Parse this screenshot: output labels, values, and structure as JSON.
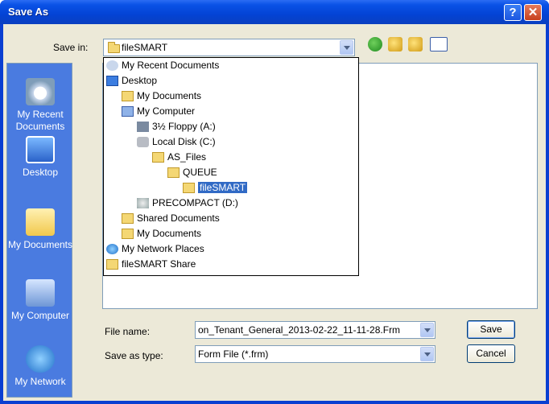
{
  "window": {
    "title": "Save As"
  },
  "toolbar": {
    "save_in_label": "Save in:",
    "save_in_value": "fileSMART"
  },
  "places": [
    {
      "label": "My Recent Documents"
    },
    {
      "label": "Desktop"
    },
    {
      "label": "My Documents"
    },
    {
      "label": "My Computer"
    },
    {
      "label": "My Network"
    }
  ],
  "dropdown": {
    "items": [
      {
        "label": "My Recent Documents"
      },
      {
        "label": "Desktop"
      },
      {
        "label": "My Documents"
      },
      {
        "label": "My Computer"
      },
      {
        "label": "3½ Floppy (A:)"
      },
      {
        "label": "Local Disk (C:)"
      },
      {
        "label": "AS_Files"
      },
      {
        "label": "QUEUE"
      },
      {
        "label": "fileSMART"
      },
      {
        "label": "PRECOMPACT (D:)"
      },
      {
        "label": "Shared Documents"
      },
      {
        "label": "My Documents"
      },
      {
        "label": "My Network Places"
      },
      {
        "label": "fileSMART Share"
      }
    ]
  },
  "form": {
    "file_name_label": "File name:",
    "file_name_value": "on_Tenant_General_2013-02-22_11-11-28.Frm",
    "save_type_label": "Save as type:",
    "save_type_value": "Form File (*.frm)"
  },
  "buttons": {
    "save": "Save",
    "cancel": "Cancel"
  },
  "colors": {
    "title_bar": "#0a52e6",
    "places_bar": "#4a7be0",
    "selection": "#316ac5"
  }
}
